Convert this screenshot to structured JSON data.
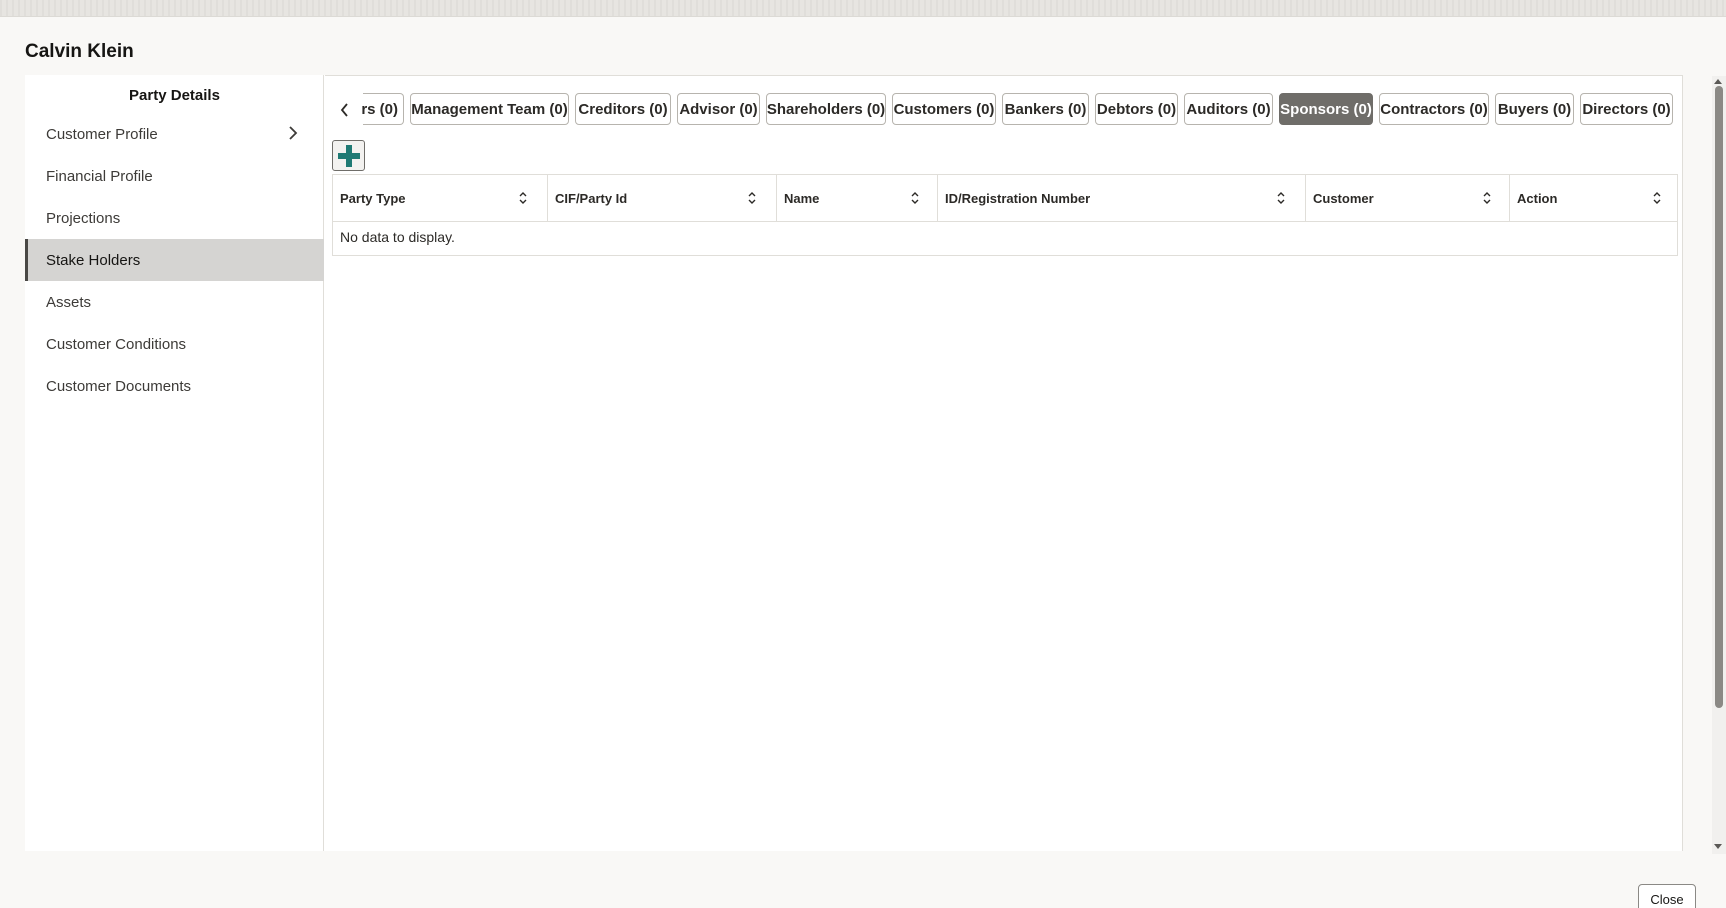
{
  "dialog": {
    "title": "Calvin Klein",
    "close_label": "Close"
  },
  "sidebar": {
    "header": "Party Details",
    "items": [
      {
        "label": "Customer Profile",
        "has_submenu": true
      },
      {
        "label": "Financial Profile"
      },
      {
        "label": "Projections"
      },
      {
        "label": "Stake Holders",
        "active": true
      },
      {
        "label": "Assets"
      },
      {
        "label": "Customer Conditions"
      },
      {
        "label": "Customer Documents"
      }
    ]
  },
  "tabs": [
    {
      "label": "rs (0)"
    },
    {
      "label": "Management Team (0)"
    },
    {
      "label": "Creditors (0)"
    },
    {
      "label": "Advisor (0)"
    },
    {
      "label": "Shareholders (0)"
    },
    {
      "label": "Customers (0)"
    },
    {
      "label": "Bankers (0)"
    },
    {
      "label": "Debtors (0)"
    },
    {
      "label": "Auditors (0)"
    },
    {
      "label": "Sponsors (0)",
      "selected": true
    },
    {
      "label": "Contractors (0)"
    },
    {
      "label": "Buyers (0)"
    },
    {
      "label": "Directors (0)"
    }
  ],
  "table": {
    "columns": [
      "Party Type",
      "CIF/Party Id",
      "Name",
      "ID/Registration Number",
      "Customer",
      "Action"
    ],
    "empty_text": "No data to display."
  },
  "icons": {
    "add": "plus-icon",
    "prev": "chevron-left-icon",
    "submenu": "chevron-right-icon",
    "sort": "sort-icon"
  },
  "colors": {
    "add_icon": "#1f7a74",
    "selected_tab": "#6f6d69"
  }
}
